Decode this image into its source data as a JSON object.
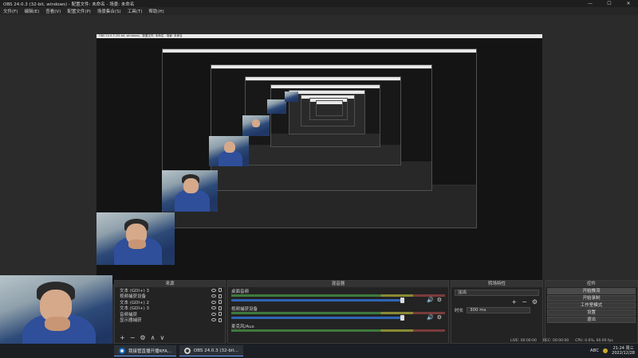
{
  "window": {
    "title": "OBS 24.0.3 (32-bit, windows) - 配置文件: 未命名 - 场景: 未命名",
    "controls": [
      "—",
      "☐",
      "✕"
    ]
  },
  "menu": [
    "文件(F)",
    "编辑(E)",
    "查看(V)",
    "配置文件(P)",
    "场景集合(S)",
    "工具(T)",
    "帮助(H)"
  ],
  "nested_title": "OBS 24.0.3 (32-bit, windows) - 配置文件: 未命名 - 场景: 未命名",
  "panels": {
    "sources_title": "来源",
    "mixer_title": "混音器",
    "transition_title": "转场特性",
    "controls_title": "控件"
  },
  "sources": [
    {
      "name": "文本 (GDI+) 3"
    },
    {
      "name": "视频捕获设备"
    },
    {
      "name": "文本 (GDI+) 2"
    },
    {
      "name": "文本 (GDI+) 3"
    },
    {
      "name": "音频捕获"
    },
    {
      "name": "显示器捕获"
    }
  ],
  "source_toolbar": [
    "+",
    "−",
    "⚙",
    "∧",
    "∨"
  ],
  "mixer": [
    {
      "name": "桌面音频",
      "level": 0.92
    },
    {
      "name": "视频捕获设备",
      "level": 0.92
    },
    {
      "name": "麦克风/Aux",
      "level": 0.92
    }
  ],
  "transition": {
    "type": "淡出",
    "duration_label": "时长",
    "duration_value": "300 ms",
    "add": "+",
    "remove": "−",
    "gear": "⚙"
  },
  "controls": [
    "开始推流",
    "开始录制",
    "工作室模式",
    "设置",
    "退出"
  ],
  "status": {
    "live": "LIVE: 00:00:00",
    "rec": "REC: 00:00:00",
    "cpu": "CPU: 0.6%, 60.00 fps"
  },
  "taskbar": {
    "tasks": [
      {
        "label": "我接管直播开播RFA..."
      },
      {
        "label": "OBS 24.0.3 (32-bit..."
      }
    ],
    "tray_text": "ABC",
    "time": "21:24 周三",
    "date": "2022/12/28"
  },
  "icons": {
    "eye": "eye-icon",
    "lock": "lock-icon",
    "speaker": "speaker-icon",
    "gear": "gear-icon"
  },
  "colors": {
    "meter_green": "#3e7a3e",
    "meter_yellow": "#8a8a35",
    "meter_red": "#7a3b3b",
    "fader_blue": "#2e65b5"
  }
}
